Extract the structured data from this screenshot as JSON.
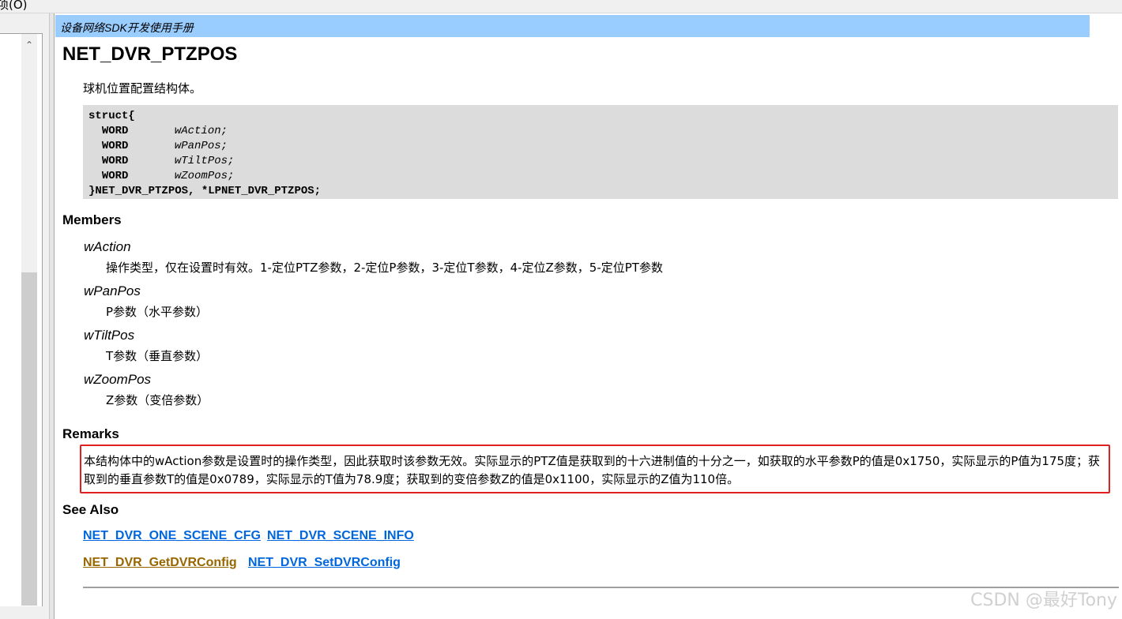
{
  "menu": {
    "item": "项(O)"
  },
  "header": {
    "title": "设备网络SDK开发使用手册"
  },
  "page": {
    "title": "NET_DVR_PTZPOS",
    "description": "球机位置配置结构体。"
  },
  "code": {
    "open": "struct{",
    "fields": [
      {
        "type": "WORD",
        "name": "wAction;"
      },
      {
        "type": "WORD",
        "name": "wPanPos;"
      },
      {
        "type": "WORD",
        "name": "wTiltPos;"
      },
      {
        "type": "WORD",
        "name": "wZoomPos;"
      }
    ],
    "close": "}NET_DVR_PTZPOS, *LPNET_DVR_PTZPOS;"
  },
  "members": {
    "heading": "Members",
    "items": [
      {
        "name": "wAction",
        "desc": "操作类型，仅在设置时有效。1-定位PTZ参数，2-定位P参数，3-定位T参数，4-定位Z参数，5-定位PT参数"
      },
      {
        "name": "wPanPos",
        "desc": "P参数（水平参数）"
      },
      {
        "name": "wTiltPos",
        "desc": "T参数（垂直参数）"
      },
      {
        "name": "wZoomPos",
        "desc": "Z参数（变倍参数）"
      }
    ]
  },
  "remarks": {
    "heading": "Remarks",
    "text": "本结构体中的wAction参数是设置时的操作类型，因此获取时该参数无效。实际显示的PTZ值是获取到的十六进制值的十分之一，如获取的水平参数P的值是0x1750，实际显示的P值为175度；获取到的垂直参数T的值是0x0789，实际显示的T值为78.9度；获取到的变倍参数Z的值是0x1100，实际显示的Z值为110倍。"
  },
  "see_also": {
    "heading": "See Also",
    "links": [
      {
        "label": "NET_DVR_ONE_SCENE_CFG",
        "state": "unvisited"
      },
      {
        "label": "NET_DVR_SCENE_INFO",
        "state": "unvisited"
      },
      {
        "label": "NET_DVR_GetDVRConfig",
        "state": "visited"
      },
      {
        "label": "NET_DVR_SetDVRConfig",
        "state": "unvisited"
      }
    ]
  },
  "colors": {
    "header_bar": "#99ccff",
    "code_bg": "#dcdcdc",
    "link": "#0066dd",
    "link_visited": "#996600",
    "remarks_highlight": "#e02020"
  },
  "watermark": "CSDN @最好Tony"
}
